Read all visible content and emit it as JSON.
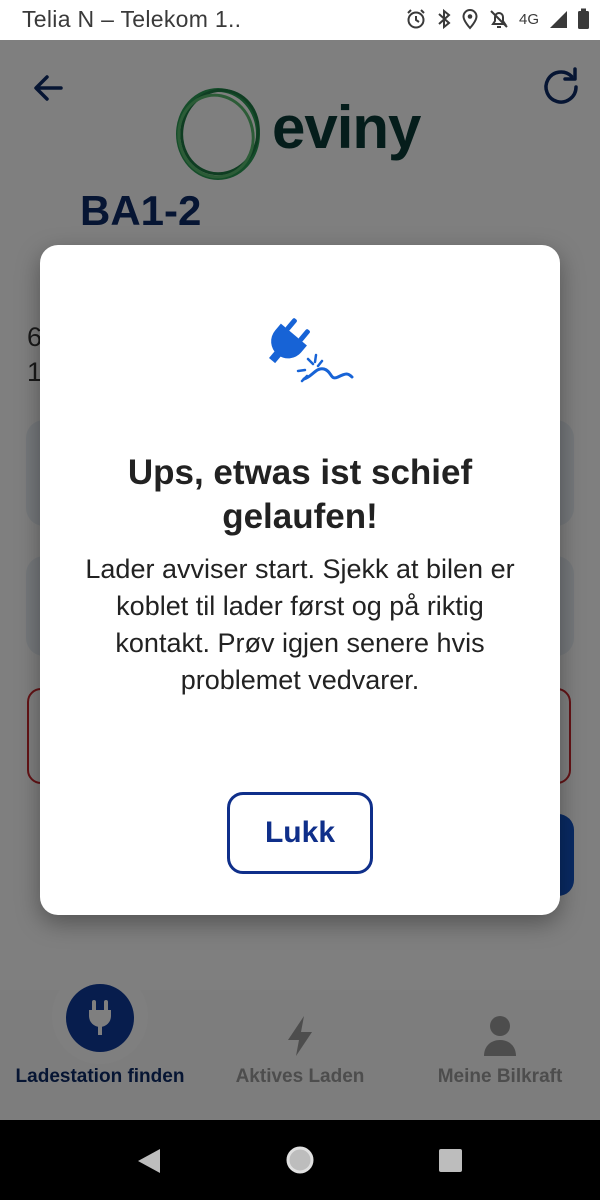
{
  "status_bar": {
    "carrier": "Telia N – Telekom  1..",
    "network": "4G",
    "icons": [
      "alarm-icon",
      "bluetooth-icon",
      "location-icon",
      "notifications-off-icon",
      "signal-icon",
      "battery-icon"
    ]
  },
  "header": {
    "logo_text": "eviny",
    "back_icon": "arrow-left-icon",
    "refresh_icon": "refresh-icon"
  },
  "station": {
    "title": "BA1-2",
    "partial_line_1": "6",
    "partial_line_2": "1"
  },
  "dialog": {
    "title": "Ups, etwas ist schief gelaufen!",
    "message": "Lader avviser start. Sjekk at bilen er koblet til lader først og på riktig kontakt. Prøv igjen senere hvis problemet vedvarer.",
    "button_label": "Lukk",
    "icon": "unplugged-icon"
  },
  "bottom_nav": {
    "items": [
      {
        "label": "Ladestation finden",
        "icon": "plug-icon",
        "active": true
      },
      {
        "label": "Aktives Laden",
        "icon": "lightning-icon",
        "active": false
      },
      {
        "label": "Meine Bilkraft",
        "icon": "person-icon",
        "active": false
      }
    ]
  },
  "colors": {
    "brand_dark_blue": "#0d2a66",
    "brand_green": "#0b3b36",
    "accent_blue": "#1255c6",
    "error_red": "#c9262c",
    "dialog_icon_blue": "#1763d6"
  }
}
